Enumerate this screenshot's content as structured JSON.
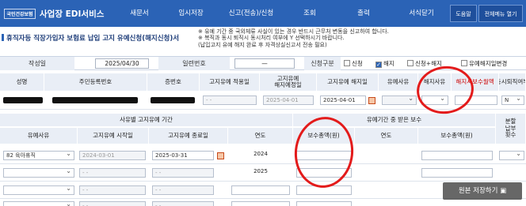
{
  "topbar": {
    "logo_text": "국민건강보험",
    "app_title": "사업장 EDI서비스",
    "nav": [
      "새문서",
      "임시저장",
      "신고(전송)/신청",
      "조회",
      "출력",
      "서식닫기"
    ],
    "help": "도움말",
    "full_menu": "전체메뉴 열기"
  },
  "page_title": "휴직자등 직장가입자 보험료 납입 고지 유예신청(해지신청)서",
  "notice": [
    "※ 유예 기간 중 국외체류 사실이 있는 경우 반드시 근무처 변동을 신고하여 합니다.",
    "※ 복직과 동시 퇴직시 동시처리 여부에 Y 선택하시기 바랍니다.",
    "   (납입고지 유예 해지 완료 후 자격상실신고서 전송 필요)"
  ],
  "search": {
    "date_label": "작성일",
    "date_value": "2025/04/30",
    "receipt_label": "일련번호",
    "receipt_value": "",
    "dash": "—",
    "type_label": "신청구분",
    "type_options": [
      {
        "label": "신청",
        "checked": false
      },
      {
        "label": "해지",
        "checked": true
      },
      {
        "label": "신청+해지",
        "checked": false
      },
      {
        "label": "유예해지일변경",
        "checked": false
      }
    ]
  },
  "grid1": {
    "headers": [
      "성명",
      "주민등록번호",
      "증번호",
      "고지유예 적용일",
      "고지유예\n해지예정일",
      "고지유예 해지일",
      "유예사유",
      "해지사유",
      "해지시보수월액",
      "동시퇴직여부"
    ],
    "row": {
      "apply_date": "- -",
      "planned_date": "2025-04-01",
      "release_date": "2025-04-01",
      "simultaneous": "N"
    }
  },
  "grid2": {
    "group_left": "사유별 고지유예 기간",
    "group_right": "유예기간 중 받은 보수",
    "side_header": "분할\n납부\n횟수",
    "headers": [
      "유예사유",
      "고지유예 시작일",
      "고지유예 종료일",
      "연도",
      "보수총액(원)",
      "연도",
      "보수총액(원)"
    ],
    "rows": [
      {
        "reason": "82 육아휴직",
        "start": "2024-03-01",
        "end": "2025-03-31",
        "year": "2024"
      },
      {
        "reason": "",
        "start": "- -",
        "end": "- -",
        "year": "2025"
      },
      {
        "reason": "",
        "start": "- -",
        "end": "- -",
        "year": ""
      },
      {
        "reason": "",
        "start": "- -",
        "end": "- -",
        "year": ""
      }
    ]
  },
  "toggle_label": "원본 저장하기",
  "accent": "#2b63b6",
  "annotation_color": "#e31b1b"
}
